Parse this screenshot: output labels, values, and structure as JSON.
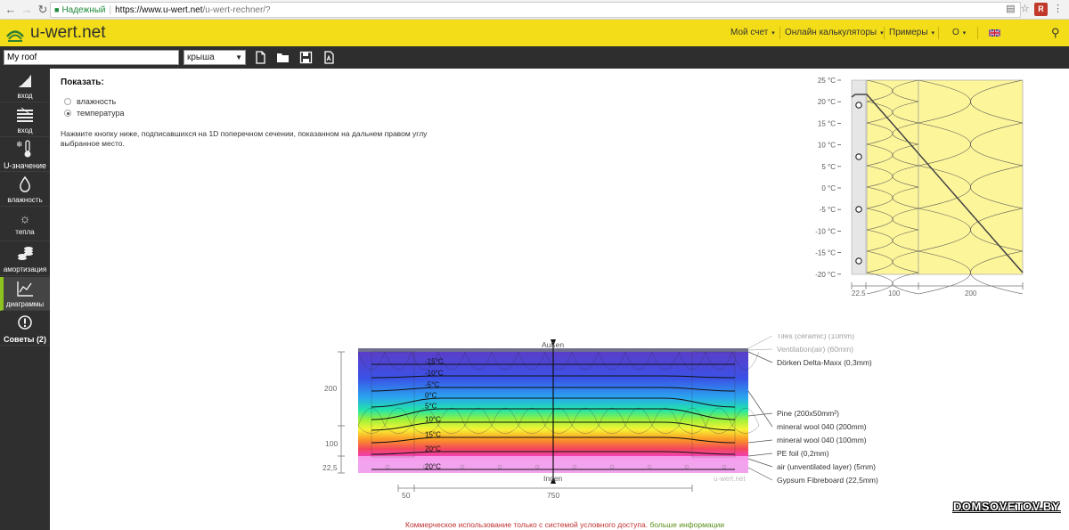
{
  "browser": {
    "secure_label": "Надежный",
    "url_host": "https://www.u-wert.net",
    "url_path": "/u-wert-rechner/?"
  },
  "header": {
    "logo_text": "u-wert.net",
    "nav": [
      "Мой счет",
      "Онлайн калькуляторы",
      "Примеры",
      "О"
    ]
  },
  "toolbar": {
    "project_name": "My roof",
    "type_value": "крыша"
  },
  "sidebar": {
    "items": [
      {
        "label": "вход",
        "icon": "component-icon"
      },
      {
        "label": "вход",
        "icon": "layers-icon"
      },
      {
        "label": "U-значение",
        "icon": "thermometer-icon"
      },
      {
        "label": "влажность",
        "icon": "drop-icon"
      },
      {
        "label": "тепла",
        "icon": "sun-icon"
      },
      {
        "label": "амортизация",
        "icon": "coins-icon"
      },
      {
        "label": "диаграммы",
        "icon": "chart-icon"
      },
      {
        "label": "Советы (2)",
        "icon": "alert-icon"
      }
    ],
    "active_index": 6,
    "accent": "#8ec21f"
  },
  "main": {
    "show_label": "Показать:",
    "options": [
      "влажность",
      "температура"
    ],
    "selected_option": "температура",
    "hint": "Нажмите кнопку ниже, подписавшихся на 1D поперечном сечении, показанном на дальнем правом углу выбранное место."
  },
  "profile_chart": {
    "temp_ticks": [
      "25 °C",
      "20 °C",
      "15 °C",
      "10 °C",
      "5 °C",
      "0 °C",
      "-5 °C",
      "-10 °C",
      "-15 °C",
      "-20 °C"
    ],
    "thickness_labels": [
      "22.5",
      "100",
      "200"
    ]
  },
  "section_chart": {
    "top_label": "Außen",
    "bottom_label": "Innen",
    "credit": "u-wert.net",
    "isotherms": [
      "-15°C",
      "-10°C",
      "-5°C",
      "0°C",
      "5°C",
      "10°C",
      "15°C",
      "20°C",
      "20°C"
    ],
    "left_dims": [
      "200",
      "100",
      "22,5"
    ],
    "bottom_dims": [
      "50",
      "750"
    ],
    "layers": [
      {
        "label": "Tiles (ceramic) (10mm)",
        "muted": true
      },
      {
        "label": "Ventilation(air) (60mm)",
        "muted": true
      },
      {
        "label": "Dörken Delta-Maxx (0,3mm)",
        "muted": false
      },
      {
        "label": "Pine (200x50mm²)",
        "muted": false
      },
      {
        "label": "mineral wool 040 (200mm)",
        "muted": false
      },
      {
        "label": "mineral wool 040 (100mm)",
        "muted": false
      },
      {
        "label": "PE foil (0,2mm)",
        "muted": false
      },
      {
        "label": "air (unventilated layer) (5mm)",
        "muted": false
      },
      {
        "label": "Gypsum Fibreboard (22,5mm)",
        "muted": false
      }
    ]
  },
  "footer": {
    "note": "Коммерческое использование только с системой условного доступа.",
    "link": "больше информации"
  },
  "watermark": "DOMSOVETOV.BY"
}
